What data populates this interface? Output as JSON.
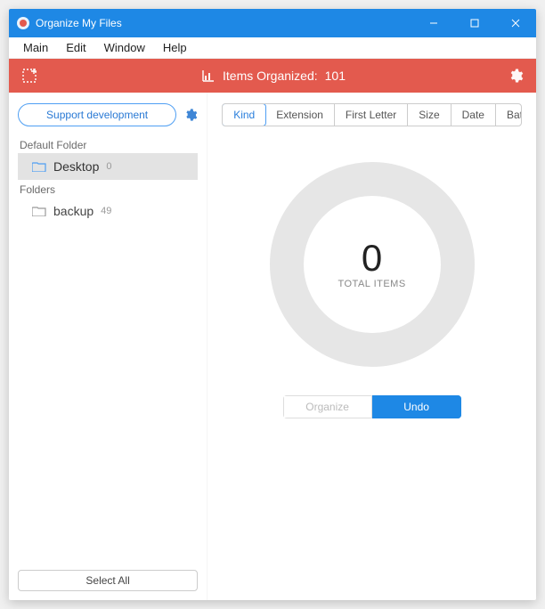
{
  "window": {
    "title": "Organize My Files"
  },
  "menubar": {
    "items": [
      "Main",
      "Edit",
      "Window",
      "Help"
    ]
  },
  "toolbar": {
    "status_prefix": "Items Organized:",
    "status_count": "101"
  },
  "sidebar": {
    "support_label": "Support development",
    "section_default": "Default Folder",
    "section_folders": "Folders",
    "default_folder": {
      "name": "Desktop",
      "count": "0"
    },
    "folders": [
      {
        "name": "backup",
        "count": "49"
      }
    ],
    "select_all_label": "Select All"
  },
  "main": {
    "tabs": [
      "Kind",
      "Extension",
      "First Letter",
      "Size",
      "Date",
      "Batch"
    ],
    "active_tab_index": 0,
    "total_items_value": "0",
    "total_items_label": "TOTAL ITEMS",
    "organize_label": "Organize",
    "undo_label": "Undo"
  },
  "colors": {
    "accent_blue": "#1E88E5",
    "accent_red": "#E35A4E"
  }
}
